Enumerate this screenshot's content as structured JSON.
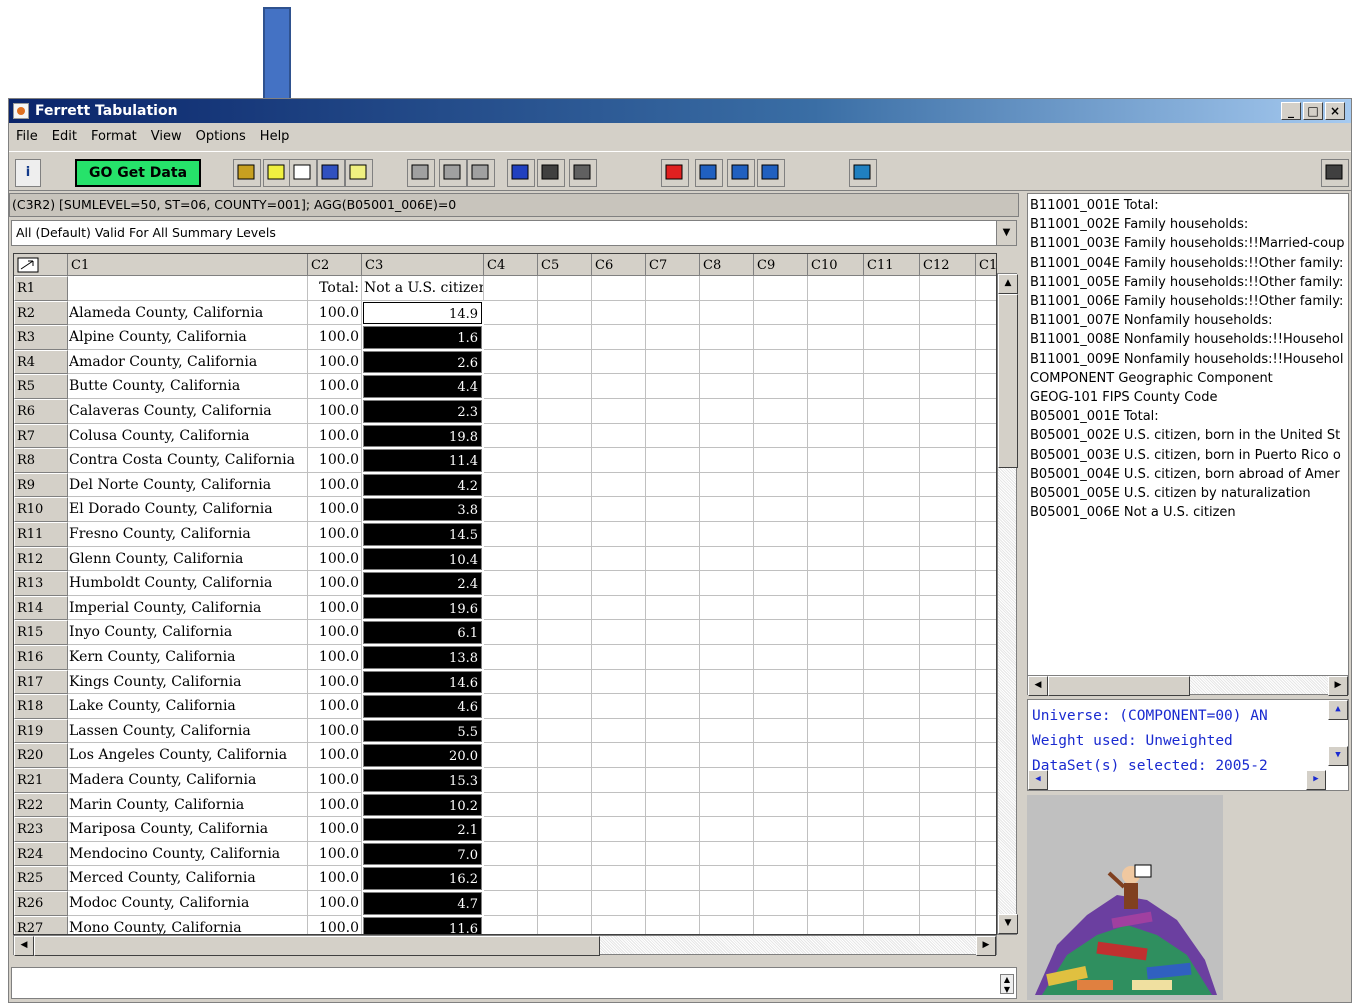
{
  "window": {
    "title": "Ferrett Tabulation"
  },
  "menu": [
    "File",
    "Edit",
    "Format",
    "View",
    "Options",
    "Help"
  ],
  "toolbar": {
    "go_button": "GO Get Data",
    "icons": [
      "bar-chart-icon",
      "map-icon",
      "outline-map-icon",
      "line-chart-icon",
      "spreadsheet-icon",
      "sort-ascending-icon",
      "sort-descending-icon",
      "clear-icon",
      "table-icon",
      "scatter-icon",
      "eye-icon",
      "cancel-icon",
      "percent-table-icon",
      "percent-table2-icon",
      "table-grid-icon",
      "camera-icon",
      "mouse-icon"
    ]
  },
  "query": "(C3R2) [SUMLEVEL=50, ST=06, COUNTY=001]; AGG(B05001_006E)=0",
  "summary_level": "All (Default)  Valid For All Summary Levels",
  "grid": {
    "col_headers": [
      "C1",
      "C2",
      "C3",
      "C4",
      "C5",
      "C6",
      "C7",
      "C8",
      "C9",
      "C10",
      "C11",
      "C12",
      "C1"
    ],
    "r1": {
      "label": "R1",
      "c2": "Total:",
      "c3": "Not a U.S. citizen"
    },
    "rows": [
      {
        "r": "R2",
        "name": "Alameda County, California",
        "total": "100.0",
        "val": "14.9"
      },
      {
        "r": "R3",
        "name": "Alpine County, California",
        "total": "100.0",
        "val": "1.6"
      },
      {
        "r": "R4",
        "name": "Amador County, California",
        "total": "100.0",
        "val": "2.6"
      },
      {
        "r": "R5",
        "name": "Butte County, California",
        "total": "100.0",
        "val": "4.4"
      },
      {
        "r": "R6",
        "name": "Calaveras County, California",
        "total": "100.0",
        "val": "2.3"
      },
      {
        "r": "R7",
        "name": "Colusa County, California",
        "total": "100.0",
        "val": "19.8"
      },
      {
        "r": "R8",
        "name": "Contra Costa County, California",
        "total": "100.0",
        "val": "11.4"
      },
      {
        "r": "R9",
        "name": "Del Norte County, California",
        "total": "100.0",
        "val": "4.2"
      },
      {
        "r": "R10",
        "name": "El Dorado County, California",
        "total": "100.0",
        "val": "3.8"
      },
      {
        "r": "R11",
        "name": "Fresno County, California",
        "total": "100.0",
        "val": "14.5"
      },
      {
        "r": "R12",
        "name": "Glenn County, California",
        "total": "100.0",
        "val": "10.4"
      },
      {
        "r": "R13",
        "name": "Humboldt County, California",
        "total": "100.0",
        "val": "2.4"
      },
      {
        "r": "R14",
        "name": "Imperial County, California",
        "total": "100.0",
        "val": "19.6"
      },
      {
        "r": "R15",
        "name": "Inyo County, California",
        "total": "100.0",
        "val": "6.1"
      },
      {
        "r": "R16",
        "name": "Kern County, California",
        "total": "100.0",
        "val": "13.8"
      },
      {
        "r": "R17",
        "name": "Kings County, California",
        "total": "100.0",
        "val": "14.6"
      },
      {
        "r": "R18",
        "name": "Lake County, California",
        "total": "100.0",
        "val": "4.6"
      },
      {
        "r": "R19",
        "name": "Lassen County, California",
        "total": "100.0",
        "val": "5.5"
      },
      {
        "r": "R20",
        "name": "Los Angeles County, California",
        "total": "100.0",
        "val": "20.0"
      },
      {
        "r": "R21",
        "name": "Madera County, California",
        "total": "100.0",
        "val": "15.3"
      },
      {
        "r": "R22",
        "name": "Marin County, California",
        "total": "100.0",
        "val": "10.2"
      },
      {
        "r": "R23",
        "name": "Mariposa County, California",
        "total": "100.0",
        "val": "2.1"
      },
      {
        "r": "R24",
        "name": "Mendocino County, California",
        "total": "100.0",
        "val": "7.0"
      },
      {
        "r": "R25",
        "name": "Merced County, California",
        "total": "100.0",
        "val": "16.2"
      },
      {
        "r": "R26",
        "name": "Modoc County, California",
        "total": "100.0",
        "val": "4.7"
      },
      {
        "r": "R27",
        "name": "Mono County, California",
        "total": "100.0",
        "val": "11.6"
      }
    ]
  },
  "variables": [
    "B11001_001E Total:",
    "B11001_002E Family households:",
    "B11001_003E Family households:!!Married-coup",
    "B11001_004E Family households:!!Other family:",
    "B11001_005E Family households:!!Other family:",
    "B11001_006E Family households:!!Other family:",
    "B11001_007E Nonfamily households:",
    "B11001_008E Nonfamily households:!!Househol",
    "B11001_009E Nonfamily households:!!Househol",
    "COMPONENT Geographic Component",
    "GEOG-101 FIPS County Code",
    "B05001_001E Total:",
    "B05001_002E U.S. citizen, born in the United St",
    "B05001_003E U.S. citizen, born in Puerto Rico o",
    "B05001_004E U.S. citizen, born abroad of Amer",
    "B05001_005E U.S. citizen by naturalization",
    "B05001_006E Not a U.S. citizen"
  ],
  "info": [
    "Universe: (COMPONENT=00) AN",
    "Weight used: Unweighted",
    "DataSet(s) selected: 2005-2"
  ],
  "colors": {
    "go_button": "#26e26a",
    "arrow": "#4472c4",
    "info_text": "#1a2ad0"
  }
}
